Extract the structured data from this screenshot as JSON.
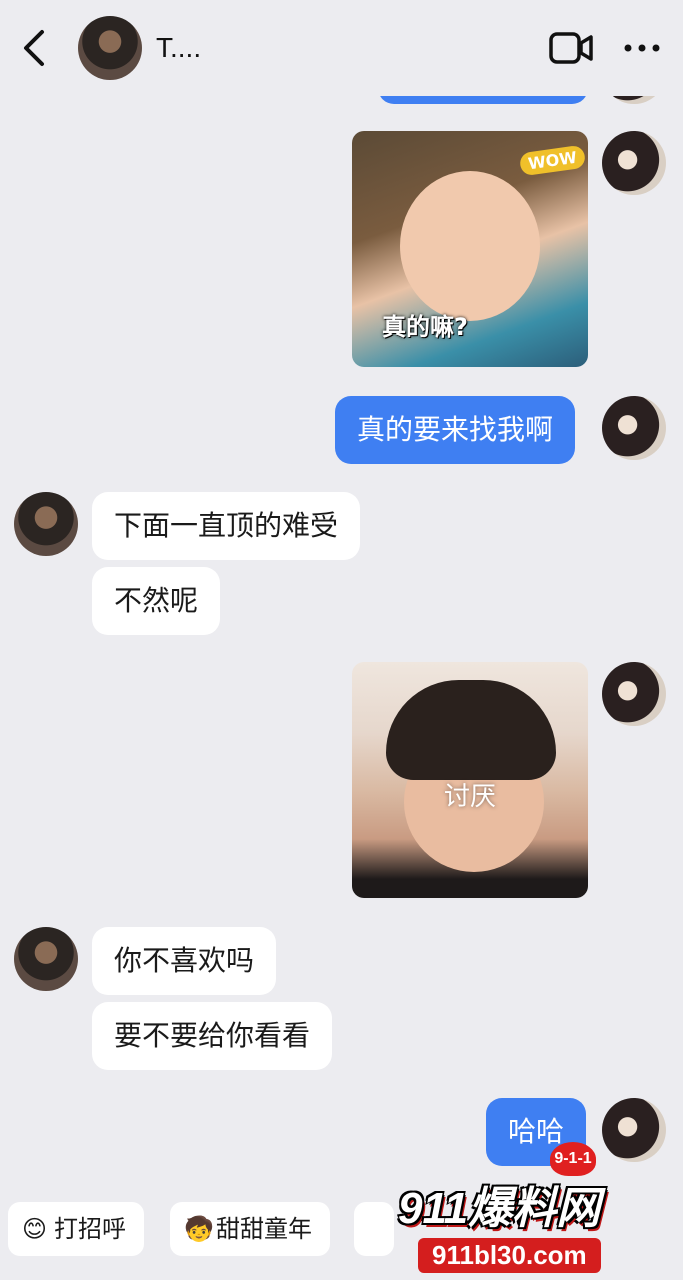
{
  "header": {
    "contact_name": "T...."
  },
  "messages": {
    "partial_top_label": "",
    "sticker_1_text": "真的嘛?",
    "sticker_1_wow": "WOW",
    "out_1": "真的要来找我啊",
    "in_1": "下面一直顶的难受",
    "in_2": "不然呢",
    "sticker_2_text": "讨厌",
    "in_3": "你不喜欢吗",
    "in_4": "要不要给你看看",
    "out_2": "哈哈"
  },
  "quick_replies": [
    {
      "icon": "smile-emoji",
      "label": "打招呼"
    },
    {
      "icon": "kid-emoji",
      "label": "甜甜童年"
    }
  ],
  "watermark": {
    "badge": "9-1-1",
    "main": "911爆料网",
    "url": "911bl30.com"
  },
  "colors": {
    "accent": "#3f7ff2",
    "background": "#ececf0",
    "incoming": "#ffffff"
  }
}
